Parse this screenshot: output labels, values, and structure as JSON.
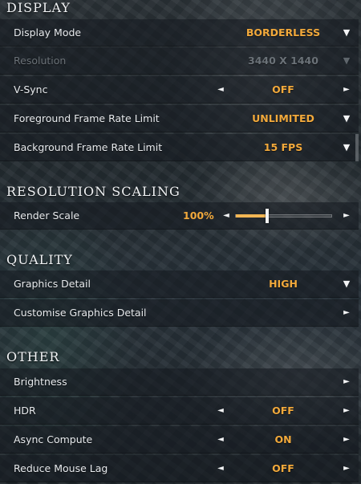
{
  "sections": {
    "display": "DISPLAY",
    "resolution_scaling": "RESOLUTION SCALING",
    "quality": "QUALITY",
    "other": "OTHER"
  },
  "display": {
    "display_mode": {
      "label": "Display Mode",
      "value": "BORDERLESS"
    },
    "resolution": {
      "label": "Resolution",
      "value": "3440 X 1440",
      "disabled": true
    },
    "vsync": {
      "label": "V-Sync",
      "value": "OFF"
    },
    "fg_frame_limit": {
      "label": "Foreground Frame Rate Limit",
      "value": "UNLIMITED"
    },
    "bg_frame_limit": {
      "label": "Background Frame Rate Limit",
      "value": "15 FPS"
    }
  },
  "resolution_scaling": {
    "render_scale": {
      "label": "Render Scale",
      "value": "100%",
      "slider_fraction": 0.33
    }
  },
  "quality": {
    "graphics_detail": {
      "label": "Graphics Detail",
      "value": "HIGH"
    },
    "customise": {
      "label": "Customise Graphics Detail"
    }
  },
  "other": {
    "brightness": {
      "label": "Brightness"
    },
    "hdr": {
      "label": "HDR",
      "value": "OFF"
    },
    "async_compute": {
      "label": "Async Compute",
      "value": "ON"
    },
    "reduce_mouse_lag": {
      "label": "Reduce Mouse Lag",
      "value": "OFF"
    }
  },
  "icons": {
    "arrow_left": "◄",
    "arrow_right": "►",
    "arrow_down": "▼"
  },
  "colors": {
    "accent": "#f2a93b",
    "row_bg": "rgba(22,28,34,0.62)"
  }
}
